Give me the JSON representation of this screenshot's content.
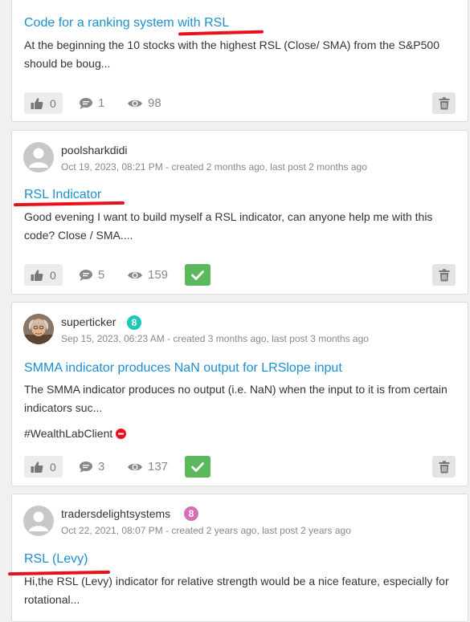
{
  "posts": [
    {
      "title": "Code for a ranking system with RSL",
      "excerpt": "At the beginning the 10 stocks with the highest RSL (Close/ SMA) from the S&P500 should be boug...",
      "likes": "0",
      "comments": "1",
      "views": "98"
    },
    {
      "username": "poolsharkdidi",
      "meta": "Oct 19, 2023, 08:21 PM - created 2 months ago, last post 2 months ago",
      "title": "RSL Indicator",
      "excerpt": "Good evening I want to build myself a RSL indicator, can anyone help me with this code? Close / SMA....",
      "likes": "0",
      "comments": "5",
      "views": "159"
    },
    {
      "username": "superticker",
      "badge": "8",
      "meta": "Sep 15, 2023, 06:23 AM - created 3 months ago, last post 3 months ago",
      "title": "SMMA indicator produces NaN output for LRSlope input",
      "excerpt": "The SMMA indicator produces no output (i.e. NaN) when the input to it is from certain indicators suc...",
      "tag": "#WealthLabClient",
      "likes": "0",
      "comments": "3",
      "views": "137"
    },
    {
      "username": "tradersdelightsystems",
      "badge": "8",
      "meta": "Oct 22, 2021, 08:07 PM - created 2 years ago, last post 2 years ago",
      "title": "RSL (Levy)",
      "excerpt": "Hi,the RSL (Levy) indicator for relative strength would be a nice feature, especially for rotational..."
    }
  ],
  "colors": {
    "link": "#1b8fd1",
    "accepted": "#5cb85c",
    "annotation": "#e8101a",
    "badge_teal": "#1ac9b8",
    "badge_pink": "#d76fb6"
  }
}
